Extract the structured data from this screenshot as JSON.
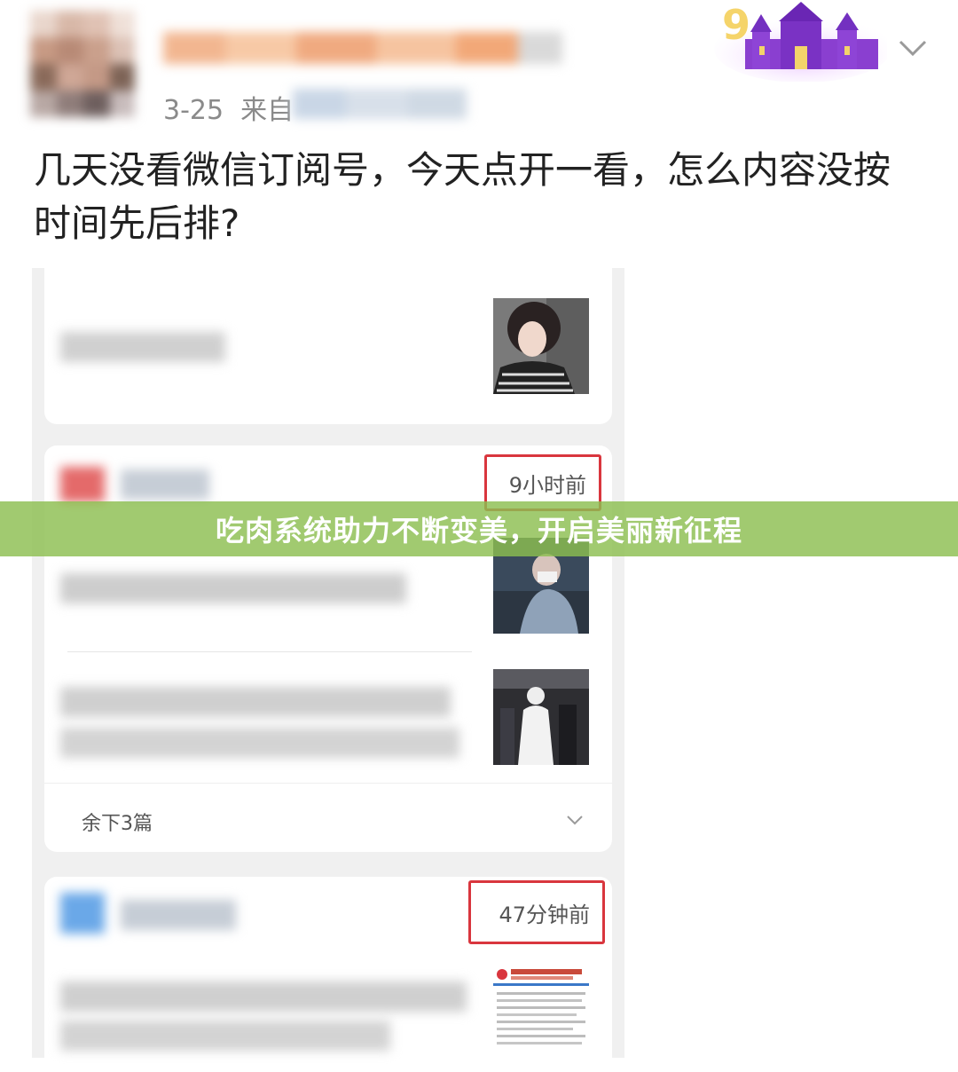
{
  "post": {
    "date": "3-25",
    "source_prefix": "来自",
    "text": "几天没看微信订阅号，今天点开一看，怎么内容没按时间先后排?"
  },
  "subscription_feed": {
    "cards": [
      {
        "timestamp": ""
      },
      {
        "timestamp": "9小时前",
        "more_label": "余下3篇"
      },
      {
        "timestamp": "47分钟前"
      }
    ]
  },
  "banner": {
    "title": "吃肉系统助力不断变美，开启美丽新征程"
  },
  "colors": {
    "banner_bg": "#8cbe50",
    "highlight_box": "#d9363e",
    "meta_text": "#8a8a8a"
  }
}
